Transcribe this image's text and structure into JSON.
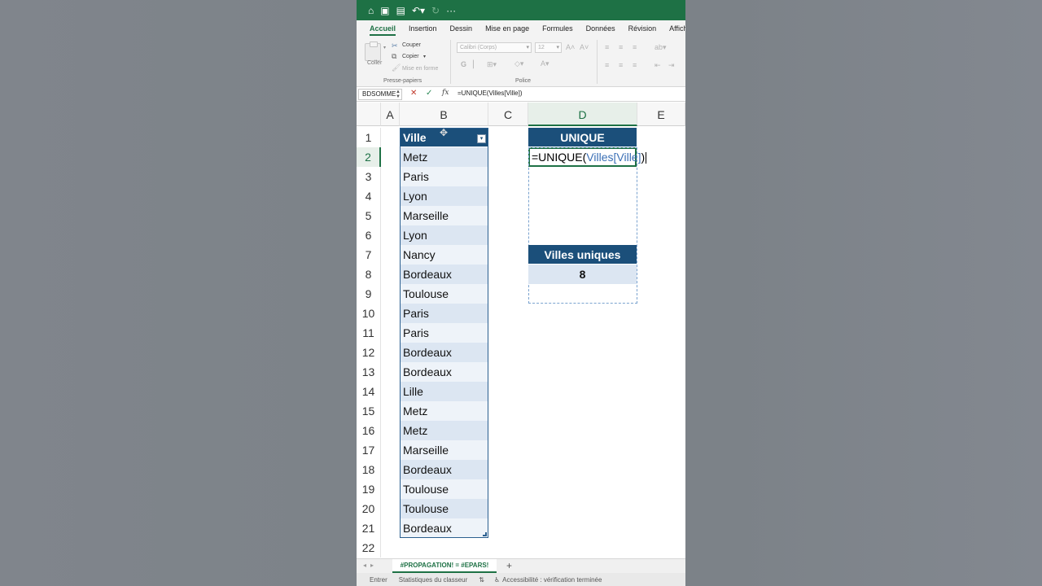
{
  "toolbar": {
    "icons": [
      "home-icon",
      "save-icon",
      "save-edit-icon",
      "undo-icon",
      "redo-icon",
      "more-icon"
    ]
  },
  "tabs": [
    "Accueil",
    "Insertion",
    "Dessin",
    "Mise en page",
    "Formules",
    "Données",
    "Révision",
    "Affich"
  ],
  "ribbon": {
    "paste_label": "Coller",
    "cut_label": "Couper",
    "copy_label": "Copier",
    "format_label": "Mise en forme",
    "clipboard_group": "Presse-papiers",
    "font_name": "Calibri (Corps)",
    "font_size": "12",
    "bold_glyph": "G",
    "font_group": "Police"
  },
  "formula_bar": {
    "name_box": "BDSOMME",
    "formula": "=UNIQUE(Villes[Ville])"
  },
  "columns": [
    "A",
    "B",
    "C",
    "D",
    "E"
  ],
  "active_column": "D",
  "rows": [
    "1",
    "2",
    "3",
    "4",
    "5",
    "6",
    "7",
    "8",
    "9",
    "10",
    "11",
    "12",
    "13",
    "14",
    "15",
    "16",
    "17",
    "18",
    "19",
    "20",
    "21",
    "22"
  ],
  "active_row": "2",
  "table": {
    "header": "Ville",
    "values": [
      "Metz",
      "Paris",
      "Lyon",
      "Marseille",
      "Lyon",
      "Nancy",
      "Bordeaux",
      "Toulouse",
      "Paris",
      "Paris",
      "Bordeaux",
      "Bordeaux",
      "Lille",
      "Metz",
      "Metz",
      "Marseille",
      "Bordeaux",
      "Toulouse",
      "Toulouse",
      "Bordeaux"
    ]
  },
  "unique_block": {
    "header": "UNIQUE",
    "edit_prefix": "=UNIQUE(",
    "edit_ref": "Villes[Ville]",
    "edit_suffix": ")",
    "count_header": "Villes uniques",
    "count_value": "8"
  },
  "sheet_tab": "#PROPAGATION! = #EPARS!",
  "add_sheet": "+",
  "status": {
    "mode": "Entrer",
    "stats": "Statistiques du classeur",
    "accessibility": "Accessibilité : vérification terminée"
  },
  "colors": {
    "excel_green": "#1e7145",
    "table_header_blue": "#1b4f7a",
    "band_blue": "#dce6f2",
    "ref_blue": "#3a6fb5"
  }
}
